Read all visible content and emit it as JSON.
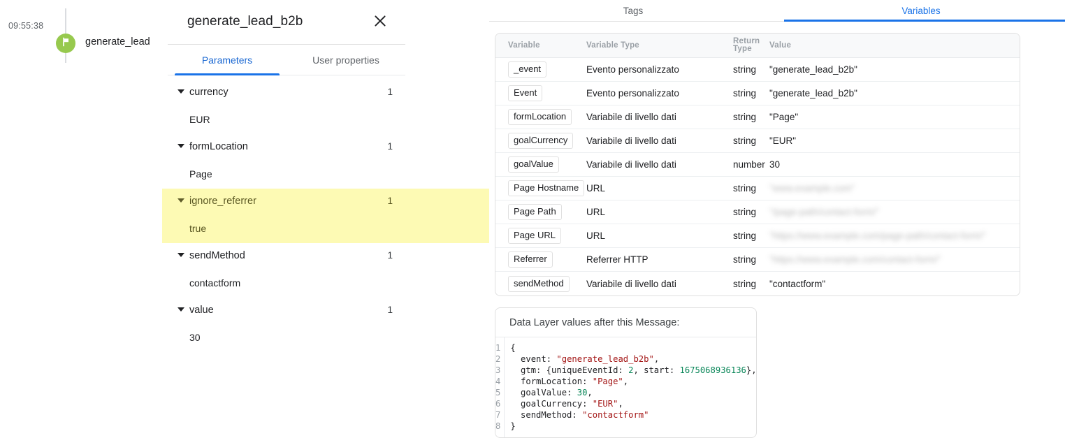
{
  "timeline": {
    "time": "09:55:38",
    "event_label": "generate_lead",
    "marker_icon": "flag-icon",
    "marker_color": "#97c94e"
  },
  "detail": {
    "title": "generate_lead_b2b",
    "close_icon": "close-icon",
    "tabs": [
      {
        "label": "Parameters",
        "active": true
      },
      {
        "label": "User properties",
        "active": false
      }
    ],
    "parameters": [
      {
        "name": "currency",
        "count": "1",
        "value": "EUR",
        "highlight": false
      },
      {
        "name": "formLocation",
        "count": "1",
        "value": "Page",
        "highlight": false
      },
      {
        "name": "ignore_referrer",
        "count": "1",
        "value": "true",
        "highlight": true
      },
      {
        "name": "sendMethod",
        "count": "1",
        "value": "contactform",
        "highlight": false
      },
      {
        "name": "value",
        "count": "1",
        "value": "30",
        "highlight": false
      }
    ]
  },
  "right": {
    "tabs": [
      {
        "label": "Tags",
        "active": false
      },
      {
        "label": "Variables",
        "active": true
      }
    ],
    "table": {
      "columns": [
        "Variable",
        "Variable Type",
        "Return Type",
        "Value"
      ],
      "rows": [
        {
          "variable": "_event",
          "type": "Evento personalizzato",
          "return_type": "string",
          "value": "\"generate_lead_b2b\"",
          "redacted": false
        },
        {
          "variable": "Event",
          "type": "Evento personalizzato",
          "return_type": "string",
          "value": "\"generate_lead_b2b\"",
          "redacted": false
        },
        {
          "variable": "formLocation",
          "type": "Variabile di livello dati",
          "return_type": "string",
          "value": "\"Page\"",
          "redacted": false
        },
        {
          "variable": "goalCurrency",
          "type": "Variabile di livello dati",
          "return_type": "string",
          "value": "\"EUR\"",
          "redacted": false
        },
        {
          "variable": "goalValue",
          "type": "Variabile di livello dati",
          "return_type": "number",
          "value": "30",
          "redacted": false
        },
        {
          "variable": "Page Hostname",
          "type": "URL",
          "return_type": "string",
          "value": "\"www.example.com\"",
          "redacted": true
        },
        {
          "variable": "Page Path",
          "type": "URL",
          "return_type": "string",
          "value": "\"/page-path/contact-form/\"",
          "redacted": true
        },
        {
          "variable": "Page URL",
          "type": "URL",
          "return_type": "string",
          "value": "\"https://www.example.com/page-path/contact-form/\"",
          "redacted": true
        },
        {
          "variable": "Referrer",
          "type": "Referrer HTTP",
          "return_type": "string",
          "value": "\"https://www.example.com/contact-form/\"",
          "redacted": true
        },
        {
          "variable": "sendMethod",
          "type": "Variabile di livello dati",
          "return_type": "string",
          "value": "\"contactform\"",
          "redacted": false
        }
      ]
    },
    "datalayer": {
      "title": "Data Layer values after this Message:",
      "line_numbers": [
        "1",
        "2",
        "3",
        "4",
        "5",
        "6",
        "7",
        "8"
      ],
      "lines": [
        [
          {
            "t": "{",
            "k": "plain"
          }
        ],
        [
          {
            "t": "  event: ",
            "k": "plain"
          },
          {
            "t": "\"generate_lead_b2b\"",
            "k": "string"
          },
          {
            "t": ",",
            "k": "plain"
          }
        ],
        [
          {
            "t": "  gtm: {uniqueEventId: ",
            "k": "plain"
          },
          {
            "t": "2",
            "k": "number"
          },
          {
            "t": ", start: ",
            "k": "plain"
          },
          {
            "t": "1675068936136",
            "k": "number"
          },
          {
            "t": "},",
            "k": "plain"
          }
        ],
        [
          {
            "t": "  formLocation: ",
            "k": "plain"
          },
          {
            "t": "\"Page\"",
            "k": "string"
          },
          {
            "t": ",",
            "k": "plain"
          }
        ],
        [
          {
            "t": "  goalValue: ",
            "k": "plain"
          },
          {
            "t": "30",
            "k": "number"
          },
          {
            "t": ",",
            "k": "plain"
          }
        ],
        [
          {
            "t": "  goalCurrency: ",
            "k": "plain"
          },
          {
            "t": "\"EUR\"",
            "k": "string"
          },
          {
            "t": ",",
            "k": "plain"
          }
        ],
        [
          {
            "t": "  sendMethod: ",
            "k": "plain"
          },
          {
            "t": "\"contactform\"",
            "k": "string"
          }
        ],
        [
          {
            "t": "}",
            "k": "plain"
          }
        ]
      ]
    }
  },
  "colors": {
    "accent_blue": "#1a73e8",
    "highlight_yellow": "#fdfab4",
    "marker_green": "#97c94e"
  }
}
